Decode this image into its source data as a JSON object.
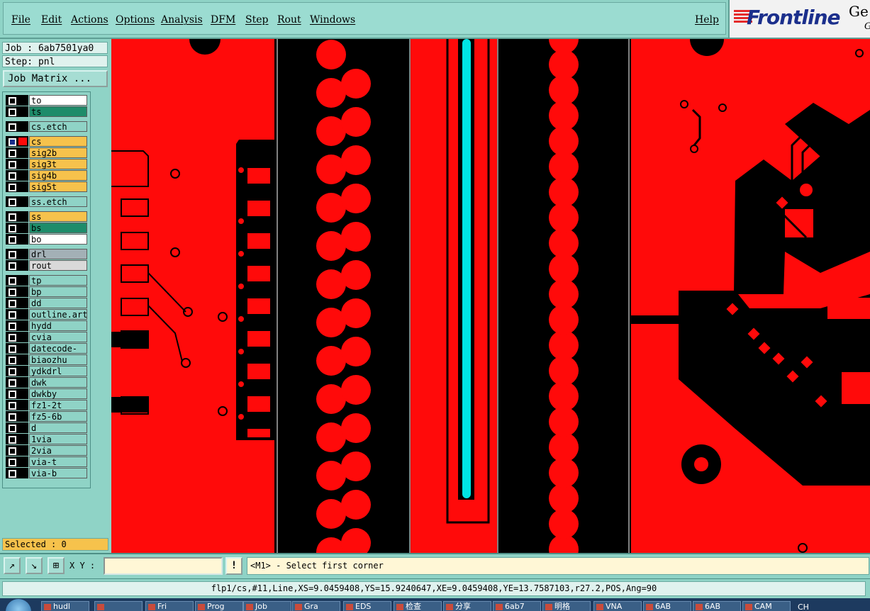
{
  "menu": {
    "items": [
      "File",
      "Edit",
      "Actions",
      "Options",
      "Analysis",
      "DFM",
      "Step",
      "Rout",
      "Windows"
    ],
    "help": "Help"
  },
  "logo": {
    "brand": "Frontline",
    "ge_text": "Ge",
    "g_text": "G"
  },
  "job": {
    "label": "Job : 6ab7501ya0",
    "step": "Step: pnl",
    "matrix_button": "Job Matrix ..."
  },
  "layers": [
    {
      "name": "to",
      "color": "#ffffff"
    },
    {
      "name": "ts",
      "color": "#1e8c6a"
    },
    {
      "name": "cs.etch",
      "color": "#8fd3c6"
    },
    {
      "name": "cs",
      "color": "#f6c24c",
      "active": true
    },
    {
      "name": "sig2b",
      "color": "#f6c24c"
    },
    {
      "name": "sig3t",
      "color": "#f6c24c"
    },
    {
      "name": "sig4b",
      "color": "#f6c24c"
    },
    {
      "name": "sig5t",
      "color": "#f6c24c"
    },
    {
      "name": "ss.etch",
      "color": "#8fd3c6"
    },
    {
      "name": "ss",
      "color": "#f6c24c"
    },
    {
      "name": "bs",
      "color": "#1e8c6a"
    },
    {
      "name": "bo",
      "color": "#ffffff"
    },
    {
      "name": "drl",
      "color": "#a3b0b6"
    },
    {
      "name": "rout",
      "color": "#d9d9d9"
    },
    {
      "name": "tp",
      "color": "#8fd3c6"
    },
    {
      "name": "bp",
      "color": "#8fd3c6"
    },
    {
      "name": "dd",
      "color": "#8fd3c6"
    },
    {
      "name": "outline.art",
      "color": "#8fd3c6"
    },
    {
      "name": "hydd",
      "color": "#8fd3c6"
    },
    {
      "name": "cvia",
      "color": "#8fd3c6"
    },
    {
      "name": "datecode-to",
      "color": "#8fd3c6"
    },
    {
      "name": "biaozhu",
      "color": "#8fd3c6"
    },
    {
      "name": "ydkdrl",
      "color": "#8fd3c6"
    },
    {
      "name": "dwk",
      "color": "#8fd3c6"
    },
    {
      "name": "dwkby",
      "color": "#8fd3c6"
    },
    {
      "name": "fz1-2t",
      "color": "#8fd3c6"
    },
    {
      "name": "fz5-6b",
      "color": "#8fd3c6"
    },
    {
      "name": "d",
      "color": "#8fd3c6"
    },
    {
      "name": "1via",
      "color": "#8fd3c6"
    },
    {
      "name": "2via",
      "color": "#8fd3c6"
    },
    {
      "name": "via-t",
      "color": "#8fd3c6"
    },
    {
      "name": "via-b",
      "color": "#8fd3c6"
    }
  ],
  "selected": "Selected : 0",
  "command": {
    "xy_label": "X Y :",
    "xy_value": "",
    "bang": "!",
    "prompt": "<M1> - Select first corner"
  },
  "status": "flp1/cs,#11,Line,XS=9.0459408,YS=15.9240647,XE=9.0459408,YE=13.7587103,r27.2,POS,Ang=90",
  "taskbar": [
    "hudl",
    "",
    "Fri",
    "Prog",
    "Job",
    "Gra",
    "EDS",
    "检查",
    "分享",
    "6ab7",
    "明格",
    "VNA",
    "6AB",
    "6AB",
    "CAM"
  ],
  "tray": "CH",
  "colors": {
    "copper": "#ff0a0a",
    "trace": "#00e5e5",
    "background": "#000000"
  }
}
